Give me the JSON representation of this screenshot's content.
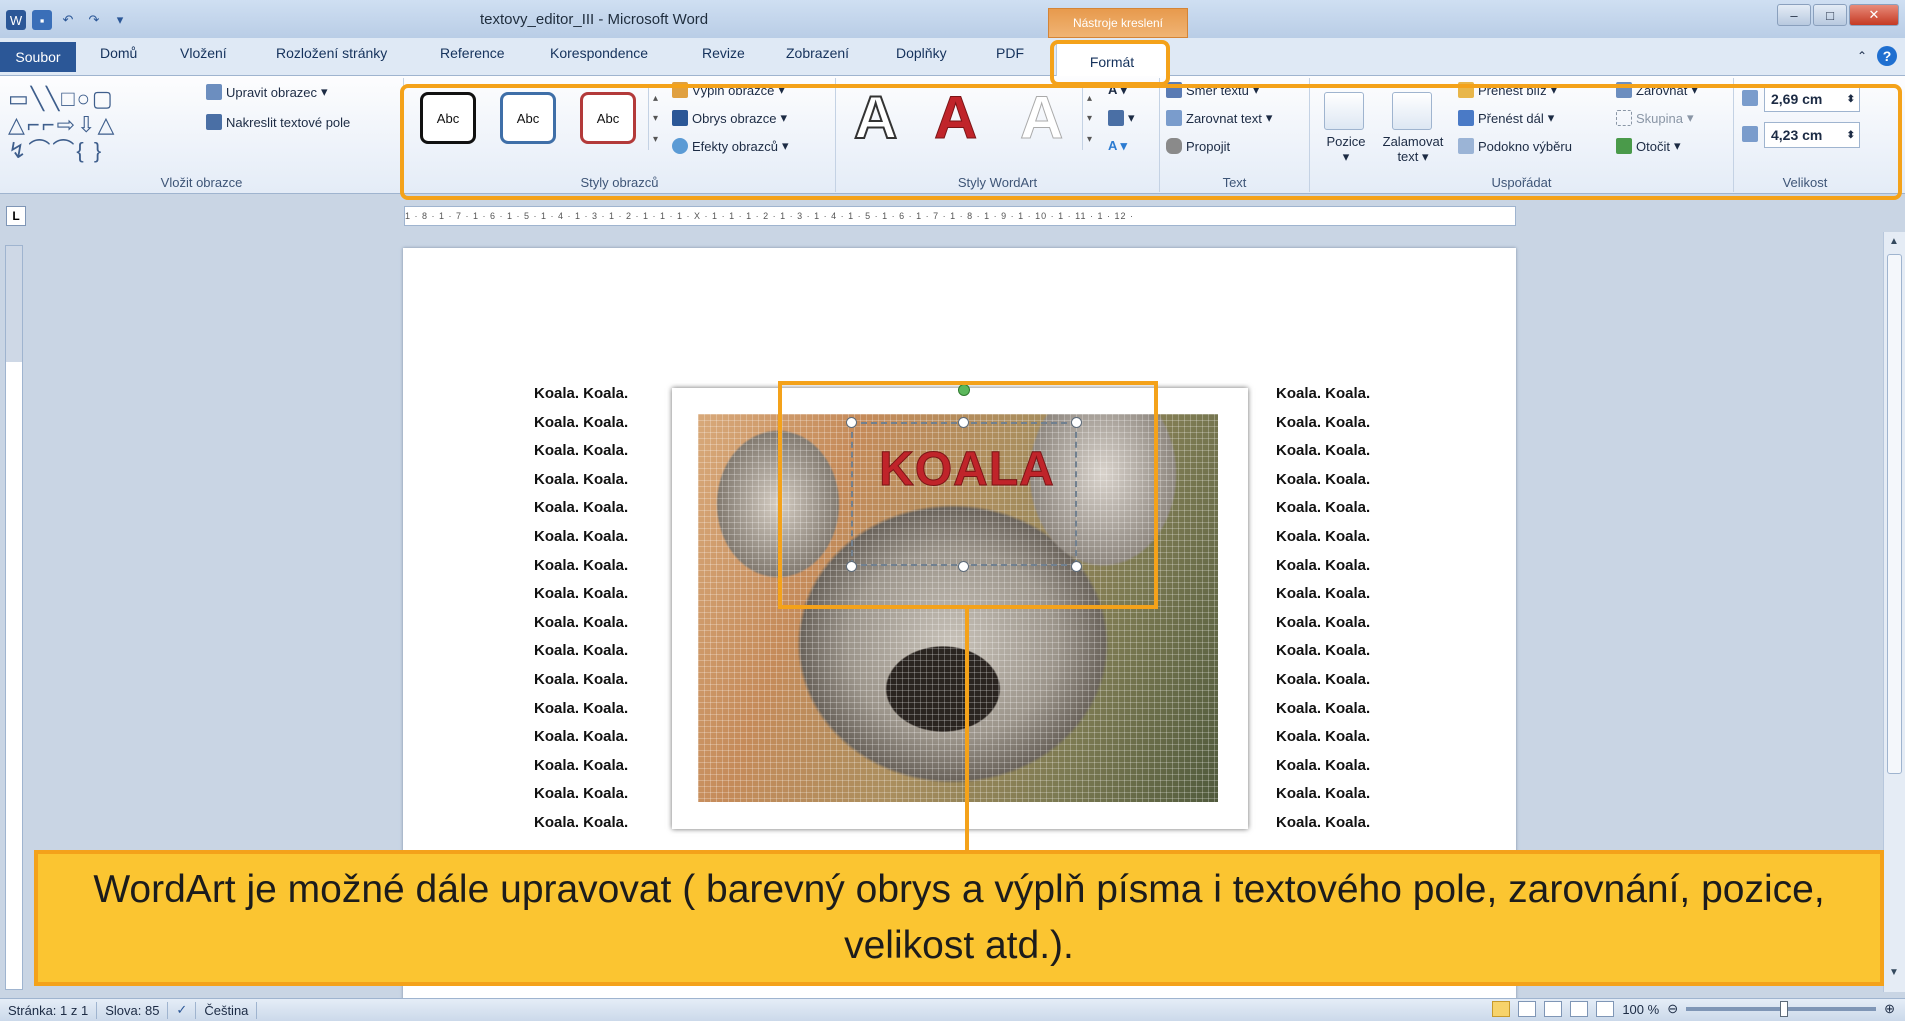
{
  "window": {
    "title": "textovy_editor_III - Microsoft Word",
    "context_tab": "Nástroje kreslení"
  },
  "tabs": [
    {
      "label": "Soubor"
    },
    {
      "label": "Domů"
    },
    {
      "label": "Vložení"
    },
    {
      "label": "Rozložení stránky"
    },
    {
      "label": "Reference"
    },
    {
      "label": "Korespondence"
    },
    {
      "label": "Revize"
    },
    {
      "label": "Zobrazení"
    },
    {
      "label": "Doplňky"
    },
    {
      "label": "PDF"
    },
    {
      "label": "Formát"
    }
  ],
  "ribbon": {
    "insert_shapes": {
      "edit_shape": "Upravit obrazec",
      "draw_textbox": "Nakreslit textové pole",
      "label": "Vložit obrazce"
    },
    "shape_styles": {
      "style1": "Abc",
      "style2": "Abc",
      "style3": "Abc",
      "fill": "Výplň obrazce",
      "outline": "Obrys obrazce",
      "effects": "Efekty obrazců",
      "label": "Styly obrazců"
    },
    "wordart_styles": {
      "glyph": "A",
      "label": "Styly WordArt"
    },
    "text": {
      "direction": "Směr textu",
      "align": "Zarovnat text",
      "link": "Propojit",
      "label": "Text"
    },
    "arrange": {
      "position": "Pozice",
      "wrap_line1": "Zalamovat",
      "wrap_line2": "text",
      "bring_forward": "Přenést blíž",
      "send_backward": "Přenést dál",
      "selection_pane": "Podokno výběru",
      "align": "Zarovnat",
      "group": "Skupina",
      "rotate": "Otočit",
      "label": "Uspořádat"
    },
    "size": {
      "height": "2,69 cm",
      "width": "4,23 cm",
      "label": "Velikost"
    }
  },
  "ruler": {
    "text": "1 · 8 · 1 · 7 · 1 · 6 · 1 · 5 · 1 · 4 · 1 · 3 · 1 · 2 · 1 · 1 · 1 · X · 1 · 1 · 1 · 2 · 1 · 3 · 1 · 4 · 1 · 5 · 1 · 6 · 1 · 7 · 1 · 8 · 1 · 9 · 1 · 10 · 1 · 11 · 1 · 12 ·"
  },
  "document": {
    "left_column": [
      "Koala. Koala.",
      "Koala. Koala.",
      "Koala. Koala.",
      "Koala. Koala.",
      "Koala. Koala.",
      "Koala. Koala.",
      "Koala. Koala.",
      "Koala. Koala.",
      "Koala. Koala.",
      "Koala. Koala.",
      "Koala. Koala.",
      "Koala. Koala.",
      "Koala. Koala.",
      "Koala. Koala.",
      "Koala. Koala.",
      "Koala. Koala."
    ],
    "right_column": [
      "Koala. Koala.",
      "Koala. Koala.",
      "Koala. Koala.",
      "Koala. Koala.",
      "Koala. Koala.",
      "Koala. Koala.",
      "Koala. Koala.",
      "Koala. Koala.",
      "Koala. Koala.",
      "Koala. Koala.",
      "Koala. Koala.",
      "Koala. Koala.",
      "Koala. Koala.",
      "Koala. Koala.",
      "Koala. Koala.",
      "Koala. Koala."
    ],
    "wordart": "KOALA"
  },
  "caption": "WordArt je možné dále upravovat ( barevný obrys a výplň písma i textového pole, zarovnání, pozice, velikost atd.).",
  "statusbar": {
    "page": "Stránka: 1 z 1",
    "words": "Slova: 85",
    "language": "Čeština",
    "zoom": "100 %"
  },
  "colors": {
    "accent": "#f4a21a",
    "caption_bg": "#fbc531",
    "wordart_fill": "#c0242a",
    "file_tab": "#2b5797"
  }
}
